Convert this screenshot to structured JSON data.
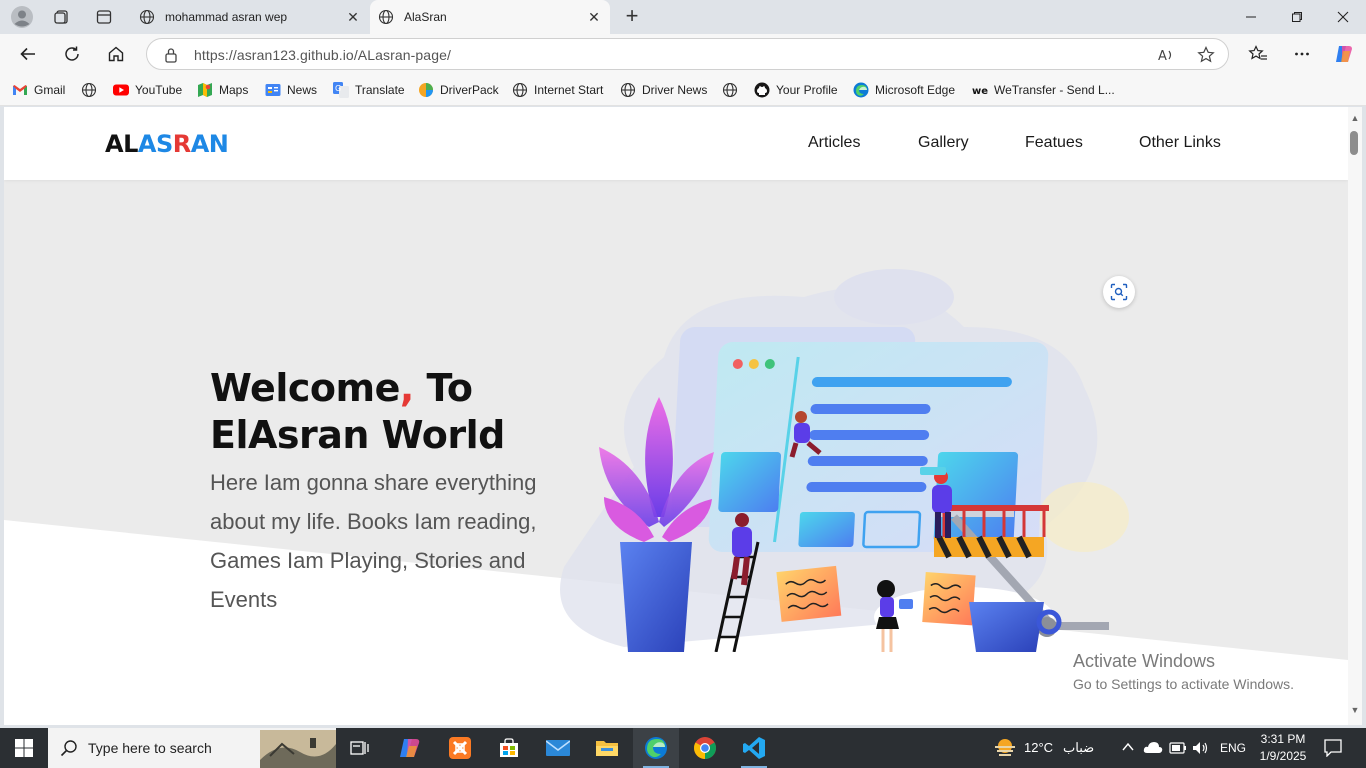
{
  "browser": {
    "tabs": [
      {
        "title": "mohammad asran wep",
        "active": false
      },
      {
        "title": "AlaSran",
        "active": true
      }
    ],
    "url": "https://asran123.github.io/ALasran-page/",
    "bookmarks": [
      {
        "label": "Gmail",
        "icon": "gmail-icon"
      },
      {
        "label": "",
        "icon": "globe-icon"
      },
      {
        "label": "YouTube",
        "icon": "youtube-icon"
      },
      {
        "label": "Maps",
        "icon": "maps-icon"
      },
      {
        "label": "News",
        "icon": "news-icon"
      },
      {
        "label": "Translate",
        "icon": "translate-icon"
      },
      {
        "label": "DriverPack",
        "icon": "driverpack-icon"
      },
      {
        "label": "Internet Start",
        "icon": "globe-icon"
      },
      {
        "label": "Driver News",
        "icon": "globe-icon"
      },
      {
        "label": "",
        "icon": "globe-icon"
      },
      {
        "label": "Your Profile",
        "icon": "github-icon"
      },
      {
        "label": "Microsoft Edge",
        "icon": "edge-icon"
      },
      {
        "label": "WeTransfer - Send L...",
        "icon": "wetransfer-icon"
      }
    ]
  },
  "site": {
    "logo": {
      "part1": "AL",
      "part2": "AS",
      "part3": "R",
      "part4": "AN"
    },
    "nav": [
      "Articles",
      "Gallery",
      "Featues",
      "Other Links"
    ],
    "hero": {
      "title_word1": "Welcome",
      "title_comma": ",",
      "title_rest1": " To",
      "title_line2": "ElAsran World",
      "subtitle": "Here Iam gonna share everything about my life. Books Iam reading, Games Iam Playing, Stories and Events"
    },
    "colors": {
      "accent_red": "#e53935",
      "accent_blue": "#1e88e5",
      "hero_bg": "#ebebeb"
    }
  },
  "watermark": {
    "line1": "Activate Windows",
    "line2": "Go to Settings to activate Windows."
  },
  "taskbar": {
    "search_placeholder": "Type here to search",
    "apps": [
      "task-view-icon",
      "copilot-icon",
      "xampp-icon",
      "store-icon",
      "mail-icon",
      "file-explorer-icon",
      "edge-icon",
      "chrome-icon",
      "vscode-icon"
    ],
    "weather_temp": "12°C",
    "weather_text": "ضباب",
    "language": "ENG",
    "time": "3:31 PM",
    "date": "1/9/2025"
  }
}
